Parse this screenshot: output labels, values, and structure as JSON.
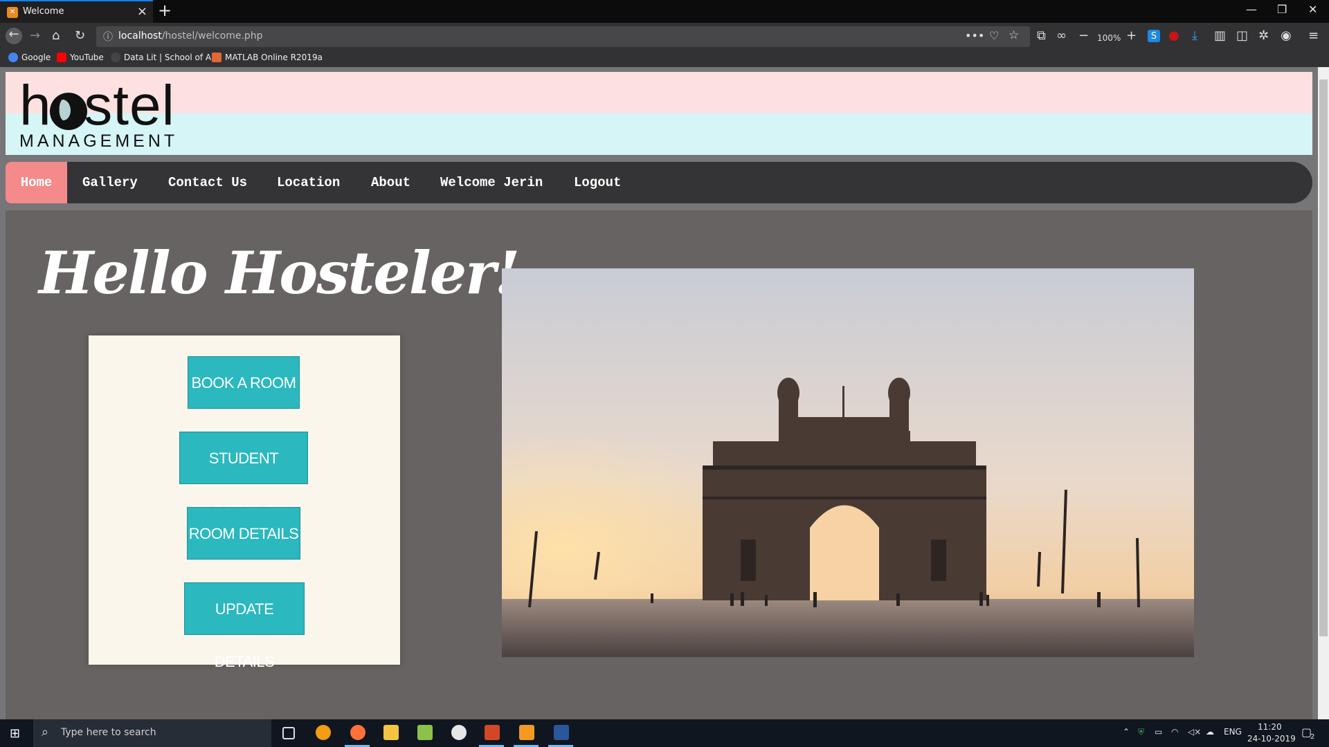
{
  "browser": {
    "tab_title": "Welcome",
    "new_tab": "+",
    "url_host": "localhost",
    "url_path": "/hostel/welcome.php",
    "zoom": "100%",
    "bookmarks": [
      {
        "label": "Google",
        "color": "#4285f4"
      },
      {
        "label": "YouTube",
        "color": "#ff0000"
      },
      {
        "label": "Data Lit | School of AI",
        "color": "#444444"
      },
      {
        "label": "MATLAB Online R2019a",
        "color": "#e16737"
      }
    ]
  },
  "page": {
    "logo_main": "hostel",
    "logo_sub": "MANAGEMENT",
    "nav": [
      "Home",
      "Gallery",
      "Contact Us",
      "Location",
      "About",
      "Welcome Jerin",
      "Logout"
    ],
    "nav_active": "Home",
    "hero_title": "Hello Hosteler!",
    "menu_buttons": [
      "BOOK A ROOM",
      "STUDENT DETAILS",
      "ROOM DETAILS",
      "UPDATE DETAILS"
    ],
    "colors": {
      "nav_bg": "#343436",
      "nav_active": "#f48a8a",
      "button": "#2bb8bf",
      "panel": "#faf6ec",
      "main_bg": "#676362"
    }
  },
  "taskbar": {
    "search_placeholder": "Type here to search",
    "lang": "ENG",
    "time": "11:20",
    "date": "24-10-2019",
    "notifications": "2"
  }
}
